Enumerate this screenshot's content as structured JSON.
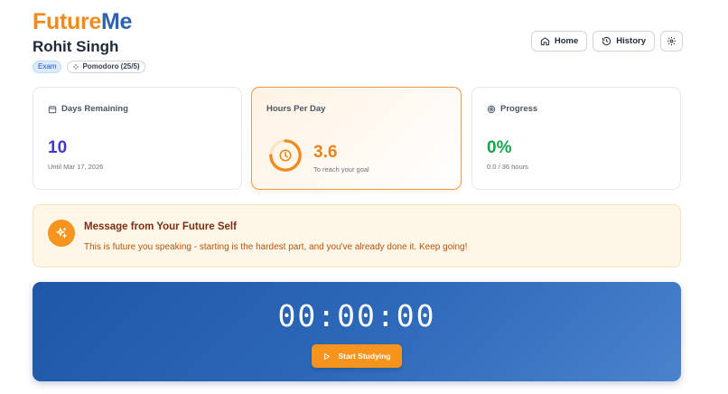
{
  "brand": {
    "part1": "Future",
    "part2": "Me"
  },
  "user": {
    "name": "Rohit Singh"
  },
  "badges": {
    "exam": "Exam",
    "pomodoro": "Pomodoro (25/5)"
  },
  "nav": {
    "home": "Home",
    "history": "History"
  },
  "cards": {
    "days": {
      "label": "Days Remaining",
      "value": "10",
      "sub": "Until Mar 17, 2026"
    },
    "hours": {
      "label": "Hours Per Day",
      "value": "3.6",
      "sub": "To reach your goal"
    },
    "progress": {
      "label": "Progress",
      "value": "0%",
      "sub": "0.0 / 36 hours"
    }
  },
  "message": {
    "title": "Message from Your Future Self",
    "body": "This is future you speaking - starting is the hardest part, and you've already done it. Keep going!"
  },
  "timer": {
    "display": "00:00:00",
    "start_label": "Start Studying"
  },
  "colors": {
    "accent": "#f7941d",
    "brand_blue": "#2e62b0",
    "progress_green": "#16a34a",
    "days_indigo": "#4338ca"
  },
  "icons": {
    "home": "home-icon",
    "history": "history-icon",
    "settings": "gear-icon",
    "calendar": "calendar-icon",
    "clock": "clock-icon",
    "target": "target-icon",
    "sparkle": "sparkle-icon",
    "play": "play-icon",
    "pomodoro": "sparkle-icon"
  }
}
